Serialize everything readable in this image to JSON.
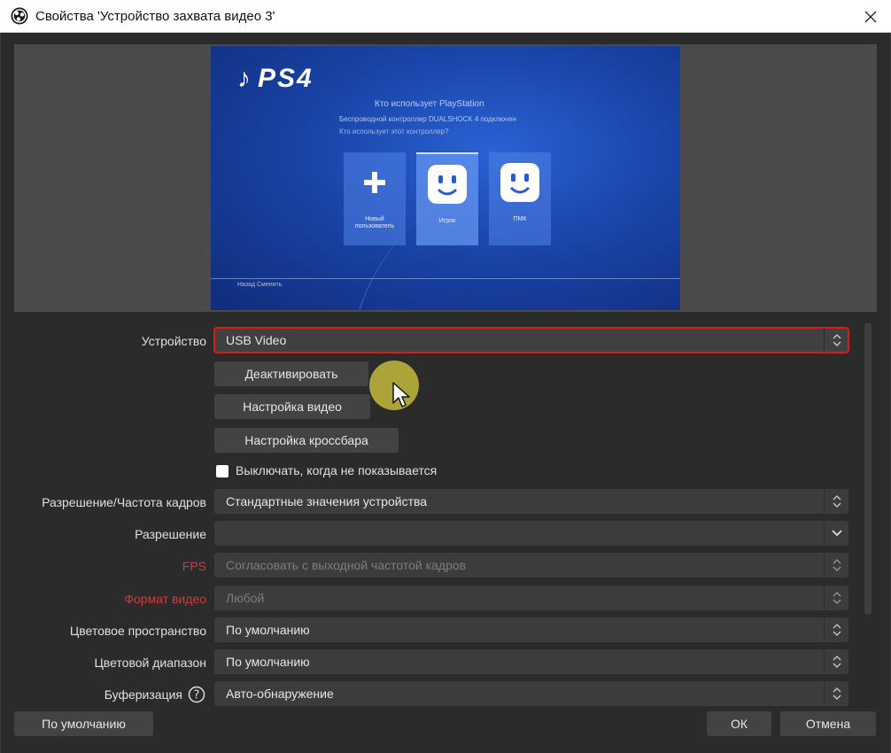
{
  "window": {
    "title": "Свойства 'Устройство захвата видео 3'"
  },
  "preview": {
    "logo_text": "PS4",
    "heading": "Кто использует PlayStation",
    "line1": "Беспроводной контроллер DUALSHOCK 4 подключен",
    "line2": "Кто использует этот контроллер?",
    "tiles": [
      {
        "icon": "plus-icon",
        "label": "Новый пользователь"
      },
      {
        "icon": "face-icon",
        "label": "Игрок"
      },
      {
        "icon": "face-icon",
        "label": "ПМК"
      }
    ],
    "footer": "Назад   Сменить"
  },
  "form": {
    "device_label": "Устройство",
    "device_value": "USB Video",
    "deactivate_button": "Деактивировать",
    "video_settings_button": "Настройка видео",
    "crossbar_button": "Настройка кроссбара",
    "hide_checkbox_label": "Выключать, когда не показывается",
    "resolution_fps_label": "Разрешение/Частота кадров",
    "resolution_fps_value": "Стандартные значения устройства",
    "resolution_label": "Разрешение",
    "resolution_value": "",
    "fps_label": "FPS",
    "fps_value": "Согласовать с выходной частотой кадров",
    "video_format_label": "Формат видео",
    "video_format_value": "Любой",
    "color_space_label": "Цветовое пространство",
    "color_space_value": "По умолчанию",
    "color_range_label": "Цветовой диапазон",
    "color_range_value": "По умолчанию",
    "buffering_label": "Буферизация",
    "buffering_value": "Авто-обнаружение"
  },
  "footer": {
    "defaults_button": "По умолчанию",
    "ok_button": "ОК",
    "cancel_button": "Отмена"
  },
  "colors": {
    "highlight_border": "#e01818",
    "disabled_label": "#d23a3a",
    "background": "#2b2b2b"
  }
}
